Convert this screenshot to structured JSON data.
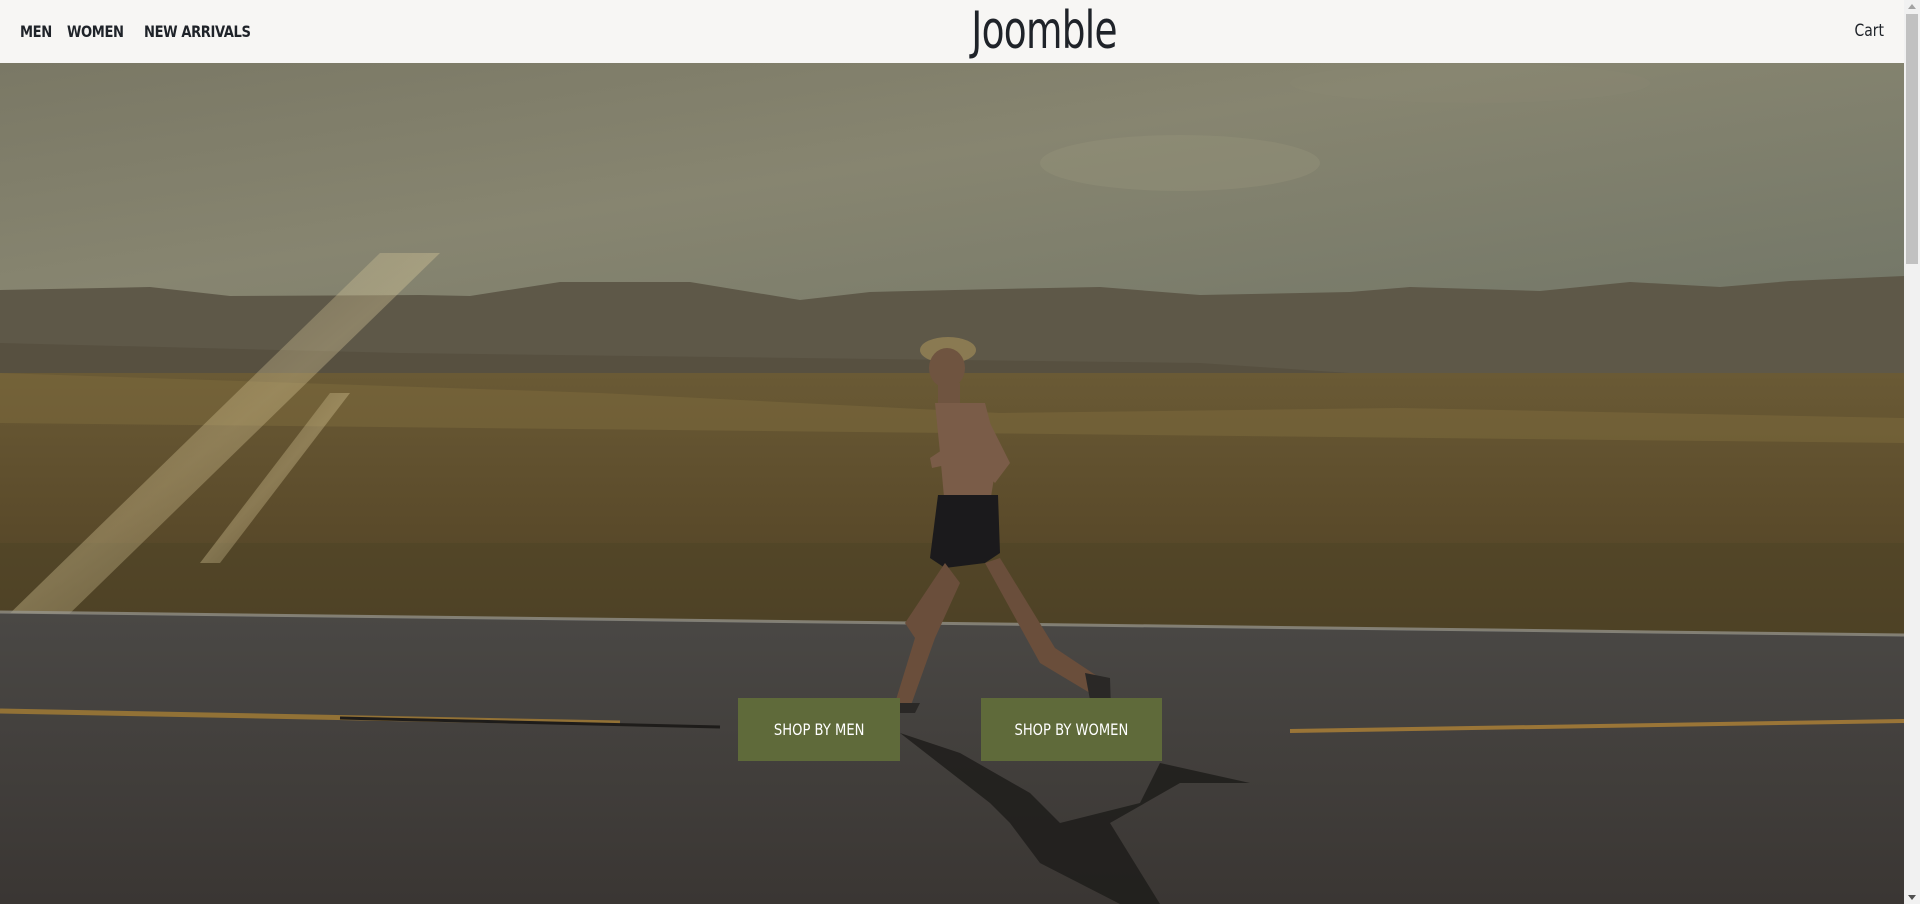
{
  "header": {
    "nav": [
      {
        "label": "MEN"
      },
      {
        "label": "WOMEN"
      },
      {
        "label": "NEW ARRIVALS"
      }
    ],
    "logo": "Joomble",
    "cart_label": "Cart"
  },
  "hero": {
    "image_subject": "runner-on-desert-road",
    "buttons": {
      "shop_men": "SHOP BY MEN",
      "shop_women": "SHOP BY WOMEN"
    }
  },
  "colors": {
    "header_bg": "#f7f6f4",
    "text": "#1f2329",
    "button_bg": "#5f6a3a",
    "button_text": "#ffffff"
  }
}
